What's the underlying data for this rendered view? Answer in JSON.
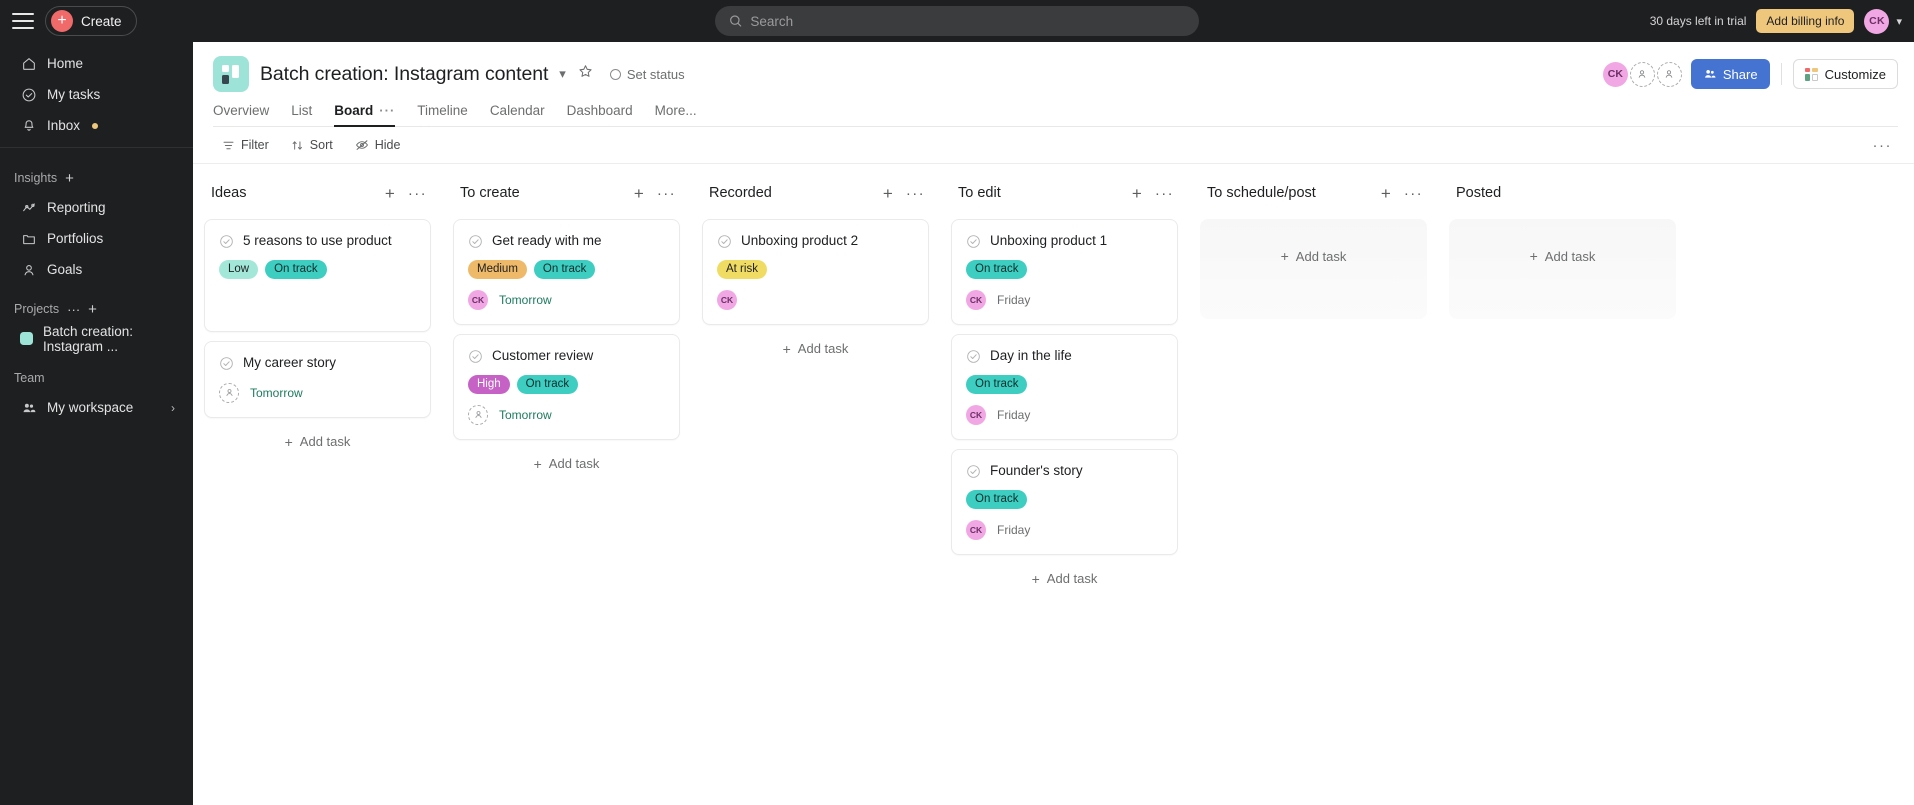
{
  "topbar": {
    "menu_icon": "hamburger-icon",
    "create_label": "Create",
    "create_icon": "plus-circle-icon",
    "search_placeholder": "Search",
    "search_value": "",
    "search_icon": "search-icon",
    "trial_text": "30 days left in trial",
    "billing_label": "Add billing info",
    "avatar_initials": "CK",
    "caret_icon": "chevron-down-icon"
  },
  "sidebar": {
    "primary": [
      {
        "label": "Home",
        "icon": "home-icon",
        "badge": false
      },
      {
        "label": "My tasks",
        "icon": "check-circle-icon",
        "badge": false
      },
      {
        "label": "Inbox",
        "icon": "bell-icon",
        "badge": true
      }
    ],
    "insights": {
      "section_label": "Insights",
      "add_icon": "plus-icon",
      "items": [
        {
          "label": "Reporting",
          "icon": "chart-line-icon"
        },
        {
          "label": "Portfolios",
          "icon": "folder-icon"
        },
        {
          "label": "Goals",
          "icon": "goal-icon"
        }
      ]
    },
    "projects": {
      "section_label": "Projects",
      "more_icon": "ellipsis-icon",
      "add_icon": "plus-icon",
      "items": [
        {
          "label": "Batch creation: Instagram ...",
          "swatch": "#9ee3d8"
        }
      ]
    },
    "team": {
      "section_label": "Team",
      "items": [
        {
          "label": "My workspace",
          "icon": "people-icon",
          "chevron": "chevron-right-icon"
        }
      ]
    }
  },
  "header": {
    "project_icon": "board-project-icon",
    "project_name": "Batch creation: Instagram content",
    "title_chevron": "chevron-down-icon",
    "star_icon": "star-outline-icon",
    "set_status_label": "Set status",
    "set_status_icon": "status-circle-icon",
    "members": [
      {
        "initials": "CK",
        "type": "avatar"
      },
      {
        "initials": "",
        "type": "empty"
      },
      {
        "initials": "",
        "type": "empty"
      }
    ],
    "share_label": "Share",
    "share_icon": "people-add-icon",
    "customize_label": "Customize",
    "customize_icon": "grid-icon",
    "tabs": [
      {
        "label": "Overview",
        "active": false
      },
      {
        "label": "List",
        "active": false
      },
      {
        "label": "Board",
        "active": true,
        "dots": "···"
      },
      {
        "label": "Timeline",
        "active": false
      },
      {
        "label": "Calendar",
        "active": false
      },
      {
        "label": "Dashboard",
        "active": false
      },
      {
        "label": "More...",
        "active": false
      }
    ]
  },
  "toolbar": {
    "filter_label": "Filter",
    "filter_icon": "filter-icon",
    "sort_label": "Sort",
    "sort_icon": "sort-icon",
    "hide_label": "Hide",
    "hide_icon": "eye-off-icon",
    "more_icon": "ellipsis-icon"
  },
  "board": {
    "add_task_label": "Add task",
    "add_task_icon": "plus-icon",
    "column_add_icon": "plus-icon",
    "column_menu_icon": "ellipsis-icon",
    "columns": [
      {
        "title": "Ideas",
        "cards": [
          {
            "title": "5 reasons to use product",
            "tags": [
              {
                "label": "Low",
                "bg": "#a3e7d8",
                "fg": "#1e1f21"
              },
              {
                "label": "On track",
                "bg": "#3ecdc1",
                "fg": "#0d2e2b"
              }
            ],
            "assignee": null,
            "due": null,
            "tall": true
          },
          {
            "title": "My career story",
            "tags": [],
            "assignee": {
              "initials": "",
              "type": "empty"
            },
            "due": {
              "text": "Tomorrow",
              "tone": "green"
            }
          }
        ],
        "show_add_task": true
      },
      {
        "title": "To create",
        "cards": [
          {
            "title": "Get ready with me",
            "tags": [
              {
                "label": "Medium",
                "bg": "#eeb968",
                "fg": "#1e1f21"
              },
              {
                "label": "On track",
                "bg": "#3ecdc1",
                "fg": "#0d2e2b"
              }
            ],
            "assignee": {
              "initials": "CK",
              "type": "avatar"
            },
            "due": {
              "text": "Tomorrow",
              "tone": "green"
            }
          },
          {
            "title": "Customer review",
            "tags": [
              {
                "label": "High",
                "bg": "#c661c6",
                "fg": "#ffffff"
              },
              {
                "label": "On track",
                "bg": "#3ecdc1",
                "fg": "#0d2e2b"
              }
            ],
            "assignee": {
              "initials": "",
              "type": "empty"
            },
            "due": {
              "text": "Tomorrow",
              "tone": "green"
            }
          }
        ],
        "show_add_task": true
      },
      {
        "title": "Recorded",
        "cards": [
          {
            "title": "Unboxing product 2",
            "tags": [
              {
                "label": "At risk",
                "bg": "#f1dc63",
                "fg": "#1e1f21"
              }
            ],
            "assignee": {
              "initials": "CK",
              "type": "avatar"
            },
            "due": null
          }
        ],
        "show_add_task": true
      },
      {
        "title": "To edit",
        "cards": [
          {
            "title": "Unboxing product 1",
            "tags": [
              {
                "label": "On track",
                "bg": "#3ecdc1",
                "fg": "#0d2e2b"
              }
            ],
            "assignee": {
              "initials": "CK",
              "type": "avatar"
            },
            "due": {
              "text": "Friday",
              "tone": "gray"
            }
          },
          {
            "title": "Day in the life",
            "tags": [
              {
                "label": "On track",
                "bg": "#3ecdc1",
                "fg": "#0d2e2b"
              }
            ],
            "assignee": {
              "initials": "CK",
              "type": "avatar"
            },
            "due": {
              "text": "Friday",
              "tone": "gray"
            }
          },
          {
            "title": "Founder's story",
            "tags": [
              {
                "label": "On track",
                "bg": "#3ecdc1",
                "fg": "#0d2e2b"
              }
            ],
            "assignee": {
              "initials": "CK",
              "type": "avatar"
            },
            "due": {
              "text": "Friday",
              "tone": "gray"
            }
          }
        ],
        "show_add_task": true
      },
      {
        "title": "To schedule/post",
        "cards": [],
        "empty_placeholder": true,
        "show_add_task": false
      },
      {
        "title": "Posted",
        "cards": [],
        "empty_placeholder": true,
        "show_add_task": false,
        "no_actions": true
      }
    ]
  }
}
